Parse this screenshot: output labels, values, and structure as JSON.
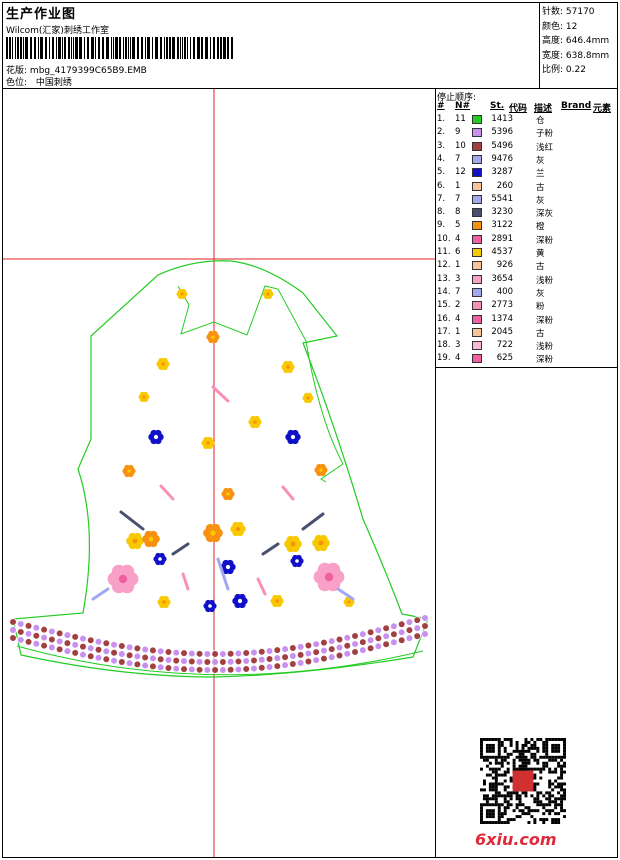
{
  "header": {
    "title": "生产作业图",
    "studio": "Wilcom(汇家)刺绣工作室",
    "pattern_label": "花版:",
    "pattern_value": "mbg_4179399C65B9.EMB",
    "color_label": "色位:",
    "color_value": "中国刺绣"
  },
  "stats": {
    "stitches": "针数: 57170",
    "colors": "颜色: 12",
    "height": "高度: 646.4mm",
    "width": "宽度: 638.8mm",
    "scale": "比例: 0.22"
  },
  "sequence": {
    "heading": "停止顺序:",
    "columns": {
      "num": "#",
      "no": "N#",
      "st": "St.",
      "code": "代码",
      "desc": "描述",
      "brand": "Brand",
      "element": "元素"
    },
    "rows": [
      {
        "num": "1.",
        "no": "11",
        "code": "1413",
        "desc": "仓",
        "color": "#22cc22"
      },
      {
        "num": "2.",
        "no": "9",
        "code": "5396",
        "desc": "子粉",
        "color": "#c891f0"
      },
      {
        "num": "3.",
        "no": "10",
        "code": "5496",
        "desc": "浅红",
        "color": "#a04040"
      },
      {
        "num": "4.",
        "no": "7",
        "code": "9476",
        "desc": "灰",
        "color": "#a0a8f0"
      },
      {
        "num": "5.",
        "no": "12",
        "code": "3287",
        "desc": "兰",
        "color": "#1010c8"
      },
      {
        "num": "6.",
        "no": "1",
        "code": "260",
        "desc": "古",
        "color": "#f8c49a"
      },
      {
        "num": "7.",
        "no": "7",
        "code": "5541",
        "desc": "灰",
        "color": "#a0a8f0"
      },
      {
        "num": "8.",
        "no": "8",
        "code": "3230",
        "desc": "深灰",
        "color": "#4a5070"
      },
      {
        "num": "9.",
        "no": "5",
        "code": "3122",
        "desc": "橙",
        "color": "#f89010"
      },
      {
        "num": "10.",
        "no": "4",
        "code": "2891",
        "desc": "深粉",
        "color": "#f060a0"
      },
      {
        "num": "11.",
        "no": "6",
        "code": "4537",
        "desc": "黄",
        "color": "#f8c800"
      },
      {
        "num": "12.",
        "no": "1",
        "code": "926",
        "desc": "古",
        "color": "#f8c49a"
      },
      {
        "num": "13.",
        "no": "3",
        "code": "3654",
        "desc": "浅粉",
        "color": "#f8a0c8"
      },
      {
        "num": "14.",
        "no": "7",
        "code": "400",
        "desc": "灰",
        "color": "#a0a8f0"
      },
      {
        "num": "15.",
        "no": "2",
        "code": "2773",
        "desc": "粉",
        "color": "#f890b8"
      },
      {
        "num": "16.",
        "no": "4",
        "code": "1374",
        "desc": "深粉",
        "color": "#f060a0"
      },
      {
        "num": "17.",
        "no": "1",
        "code": "2045",
        "desc": "古",
        "color": "#f8c49a"
      },
      {
        "num": "18.",
        "no": "3",
        "code": "722",
        "desc": "浅粉",
        "color": "#f8b8d8"
      },
      {
        "num": "19.",
        "no": "4",
        "code": "625",
        "desc": "深粉",
        "color": "#f060a0"
      }
    ]
  },
  "watermark": {
    "domain": "6xiu.com"
  },
  "colors": {
    "outline": "#22cc22",
    "guide": "#e02020"
  }
}
